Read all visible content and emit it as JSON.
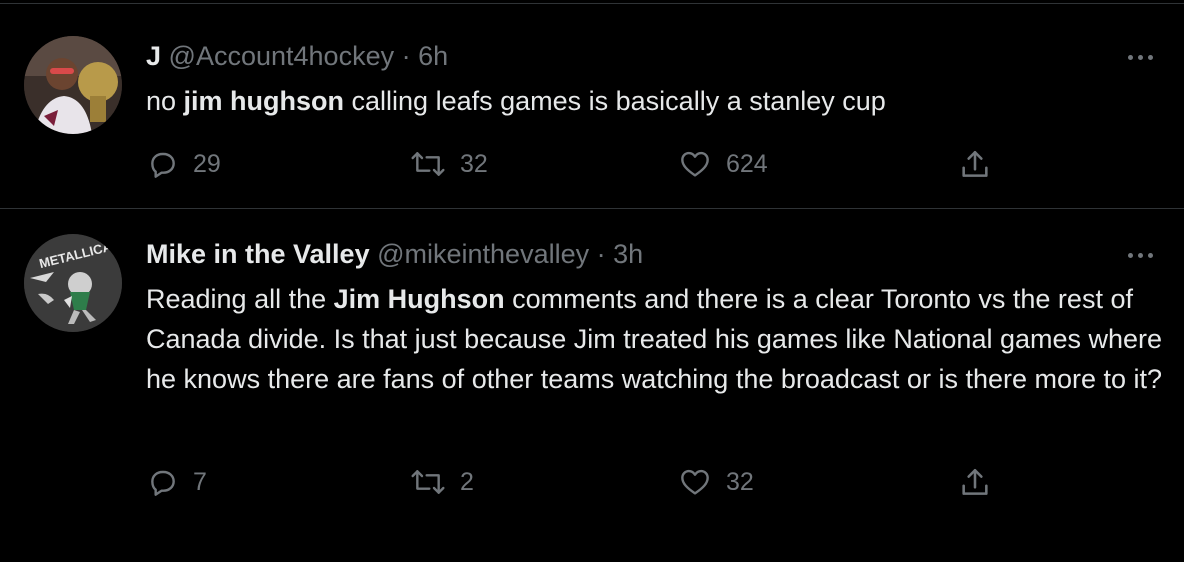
{
  "tweets": [
    {
      "name": "J",
      "handle": "@Account4hockey",
      "separator": "·",
      "time": "6h",
      "text_before": "no ",
      "text_bold": "jim hughson",
      "text_after": " calling leafs games is basically a stanley cup",
      "replies": "29",
      "retweets": "32",
      "likes": "624",
      "avatar_icon": "avatar-photo"
    },
    {
      "name": "Mike in the Valley",
      "handle": "@mikeinthevalley",
      "separator": "·",
      "time": "3h",
      "text_before": "Reading all the ",
      "text_bold": "Jim Hughson",
      "text_after": " comments and there is a clear Toronto vs the rest of Canada divide. Is that just because Jim treated his games like National games where he knows there are fans of other teams watching the broadcast or is there more to it?",
      "replies": "7",
      "retweets": "2",
      "likes": "32",
      "avatar_icon": "avatar-metallica-logo",
      "avatar_text": "METALLICA"
    }
  ],
  "icons": {
    "reply": "reply-icon",
    "retweet": "retweet-icon",
    "like": "heart-icon",
    "share": "share-icon",
    "more": "more-options-icon"
  },
  "colors": {
    "background": "#000000",
    "primary_text": "#e7e9ea",
    "secondary_text": "#71767b",
    "divider": "#2f3336"
  }
}
